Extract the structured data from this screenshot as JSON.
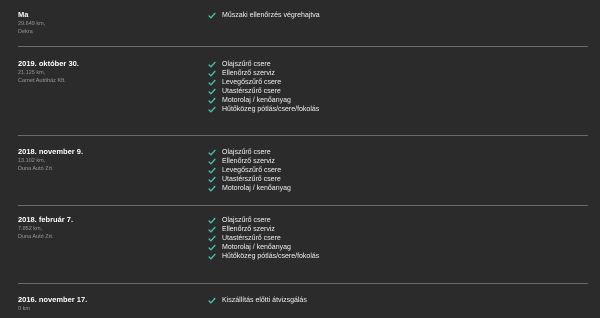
{
  "colors": {
    "background": "#2b2b2b",
    "check": "#3ec9b4",
    "divider": "#6a6a6a",
    "meta_text": "#9a9a9a"
  },
  "entries": [
    {
      "date": "Ma",
      "mileage": "29.649 km,",
      "workshop": "Dekra",
      "services": [
        "Műszaki ellenőrzés végrehajtva"
      ]
    },
    {
      "date": "2019. október 30.",
      "mileage": "21.125 km,",
      "workshop": "Carnet Autóház Kft.",
      "services": [
        "Olajszűrő csere",
        "Ellenőrző szerviz",
        "Levegőszűrő csere",
        "Utastérszűrő csere",
        "Motorolaj / kenőanyag",
        "Hűtőközeg pótlás/csere/fokolás"
      ]
    },
    {
      "date": "2018. november 9.",
      "mileage": "13.102 km,",
      "workshop": "Duna Autó Zrt.",
      "services": [
        "Olajszűrő csere",
        "Ellenőrző szerviz",
        "Levegőszűrő csere",
        "Utastérszűrő csere",
        "Motorolaj / kenőanyag"
      ]
    },
    {
      "date": "2018. február 7.",
      "mileage": "7.852 km,",
      "workshop": "Duna Autó Zrt.",
      "services": [
        "Olajszűrő csere",
        "Ellenőrző szerviz",
        "Utastérszűrő csere",
        "Motorolaj / kenőanyag",
        "Hűtőközeg pótlás/csere/fokolás"
      ]
    },
    {
      "date": "2016. november 17.",
      "mileage": "0 km",
      "workshop": "",
      "services": [
        "Kiszállítás előtti átvizsgálás"
      ]
    }
  ]
}
